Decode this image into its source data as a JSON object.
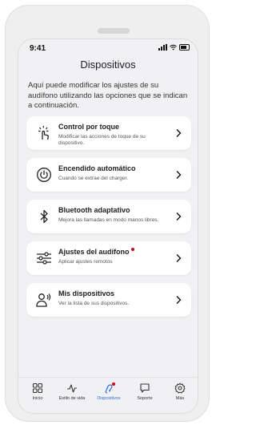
{
  "status": {
    "time": "9:41"
  },
  "header": {
    "title": "Dispositivos"
  },
  "intro": {
    "text": "Aquí puede modificar los ajustes de su audífono utilizando las opciones que se indican a continuación."
  },
  "cards": [
    {
      "title": "Control por toque",
      "subtitle": "Modificar las acciones de toque de su dispositivo.",
      "icon": "touch-icon",
      "badge": false
    },
    {
      "title": "Encendido automático",
      "subtitle": "Cuando se extrae del charger.",
      "icon": "power-icon",
      "badge": false
    },
    {
      "title": "Bluetooth adaptativo",
      "subtitle": "Mejora las llamadas en modo manos libres.",
      "icon": "bluetooth-icon",
      "badge": false
    },
    {
      "title": "Ajustes del audífono",
      "subtitle": "Aplicar ajustes remotos",
      "icon": "sliders-icon",
      "badge": true
    },
    {
      "title": "Mis dispositivos",
      "subtitle": "Ver la lista de sus dispositivos.",
      "icon": "hearing-devices-icon",
      "badge": false
    }
  ],
  "tabs": [
    {
      "label": "Inicio",
      "icon": "grid-icon",
      "active": false
    },
    {
      "label": "Estilo de vida",
      "icon": "activity-icon",
      "active": false
    },
    {
      "label": "Dispositivos",
      "icon": "hearing-aid-icon",
      "active": true,
      "badge": true
    },
    {
      "label": "Soporte",
      "icon": "chat-icon",
      "active": false
    },
    {
      "label": "Más",
      "icon": "gear-icon",
      "active": false
    }
  ],
  "colors": {
    "accent": "#2f6fd6",
    "badge": "#d0021b",
    "background": "#f1f1f3",
    "card": "#ffffff"
  }
}
